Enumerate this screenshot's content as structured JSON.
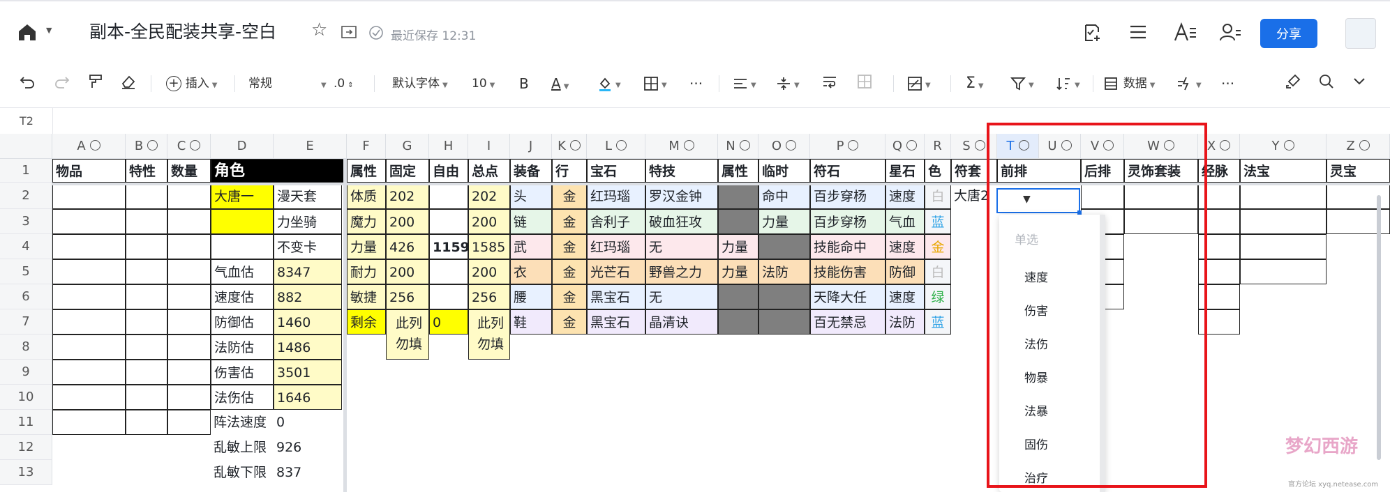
{
  "header": {
    "title": "副本-全民配装共享-空白",
    "saved_status": "最近保存 12:31",
    "share_label": "分享"
  },
  "toolbar": {
    "insert_label": "插入",
    "format_label": "常规",
    "decimal_label": ".0",
    "font_label": "默认字体",
    "font_size": "10",
    "bold_label": "B",
    "font_color_label": "A",
    "more_label": "···",
    "data_label": "数据",
    "more2_label": "···"
  },
  "formula_bar": {
    "cell_ref": "T2"
  },
  "columns": [
    "A",
    "B",
    "C",
    "D",
    "E",
    "F",
    "G",
    "H",
    "I",
    "J",
    "K",
    "L",
    "M",
    "N",
    "O",
    "P",
    "Q",
    "R",
    "S",
    "T",
    "U",
    "V",
    "W",
    "X",
    "Y",
    "Z"
  ],
  "rows": [
    "1",
    "2",
    "3",
    "4",
    "5",
    "6",
    "7",
    "8",
    "9",
    "10",
    "11",
    "12",
    "13"
  ],
  "row1": {
    "A": "物品",
    "B": "特性",
    "C": "数量",
    "D": "角色",
    "F": "属性",
    "G": "固定",
    "H": "自由",
    "I": "总点",
    "J": "装备",
    "K": "行",
    "L": "宝石",
    "M": "特技",
    "N": "属性",
    "O": "临时",
    "P": "符石",
    "Q": "星石",
    "R": "色",
    "S": "符套",
    "T": "前排",
    "U": "后排",
    "W": "灵饰套装",
    "X": "经脉",
    "Y": "法宝",
    "Z": "灵宝"
  },
  "colD": [
    "大唐一",
    "",
    "",
    "气血估",
    "速度估",
    "防御估",
    "法防估",
    "伤害估",
    "法伤估",
    "阵法速度",
    "乱敏上限",
    "乱敏下限"
  ],
  "colE": [
    "漫天套",
    "力坐骑",
    "不变卡",
    "8347",
    "882",
    "1460",
    "1486",
    "3501",
    "1646",
    "0",
    "926",
    "837"
  ],
  "colF": [
    "体质",
    "魔力",
    "力量",
    "耐力",
    "敏捷",
    "剩余"
  ],
  "colG": [
    "202",
    "200",
    "426",
    "200",
    "256"
  ],
  "colG_note": "此列勿填",
  "colH": [
    "",
    "",
    "1159",
    "",
    "",
    "0"
  ],
  "colI": [
    "202",
    "200",
    "1585",
    "200",
    "256"
  ],
  "colI_note": "此列勿填",
  "colJ": [
    "头",
    "链",
    "武",
    "衣",
    "腰",
    "鞋"
  ],
  "colK": [
    "金",
    "金",
    "金",
    "金",
    "金",
    "金"
  ],
  "colL": [
    "红玛瑙",
    "舍利子",
    "红玛瑙",
    "光芒石",
    "黑宝石",
    "黑宝石"
  ],
  "colM": [
    "罗汉金钟",
    "破血狂攻",
    "无",
    "野兽之力",
    "无",
    "晶清诀"
  ],
  "colN": [
    "",
    "",
    "力量",
    "力量",
    "",
    ""
  ],
  "colO": [
    "命中",
    "力量",
    "",
    "法防",
    "",
    ""
  ],
  "colP": [
    "百步穿杨",
    "百步穿杨",
    "技能命中",
    "技能伤害",
    "天降大任",
    "百无禁忌"
  ],
  "colQ": [
    "速度",
    "气血",
    "速度",
    "防御",
    "速度",
    "法防"
  ],
  "colR": [
    "白",
    "蓝",
    "金",
    "白",
    "绿",
    "蓝"
  ],
  "colS": [
    "大唐2"
  ],
  "dropdown": {
    "title": "单选",
    "options": [
      "速度",
      "伤害",
      "法伤",
      "物暴",
      "法暴",
      "固伤",
      "治疗"
    ]
  },
  "watermark": {
    "text": "梦幻西游",
    "subtext": "官方论坛 xyq.netease.com"
  },
  "colors": {
    "accent": "#1a6fe8",
    "highlight": "#e8141a",
    "yellow": "#ffff00"
  }
}
